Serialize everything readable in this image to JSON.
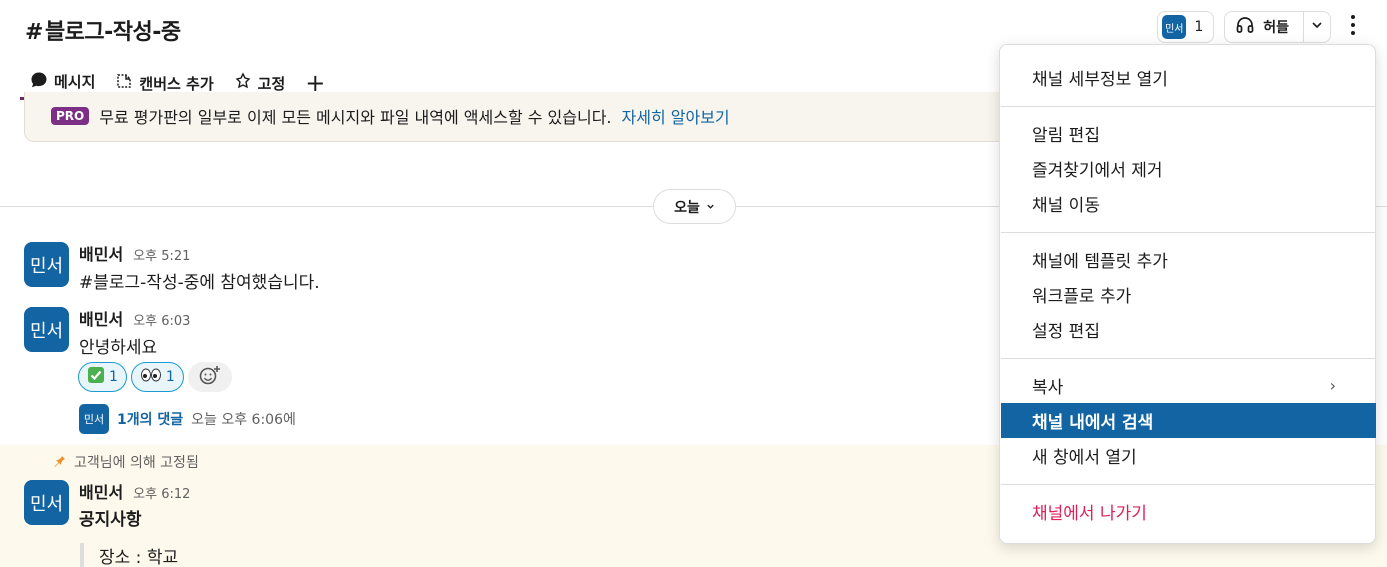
{
  "header": {
    "channel_hash": "#",
    "channel_name": "블로그-작성-중",
    "member_avatar": "민서",
    "member_count": "1",
    "huddle_label": "허들"
  },
  "tabs": [
    {
      "label": "메시지",
      "icon": "message-icon"
    },
    {
      "label": "캔버스 추가",
      "icon": "canvas-icon"
    },
    {
      "label": "고정",
      "icon": "pin-icon"
    }
  ],
  "add_tab": "+",
  "banner": {
    "badge": "PRO",
    "text": "무료 평가판의 일부로 이제 모든 메시지와 파일 내역에 액세스할 수 있습니다.",
    "link": "자세히 알아보기"
  },
  "date_divider": {
    "label": "오늘"
  },
  "messages": [
    {
      "avatar": "민서",
      "author": "배민서",
      "time": "오후 5:21",
      "text": "#블로그-작성-중에 참여했습니다."
    },
    {
      "avatar": "민서",
      "author": "배민서",
      "time": "오후 6:03",
      "text": "안녕하세요",
      "reactions": [
        {
          "emoji": "✅",
          "count": "1"
        },
        {
          "emoji": "👀",
          "count": "1"
        }
      ],
      "thread": {
        "avatar": "민서",
        "replies": "1개의 댓글",
        "last": "오늘 오후 6:06에"
      }
    },
    {
      "avatar": "민서",
      "author": "배민서",
      "time": "오후 6:12",
      "text": "공지사항",
      "pinned_by": "고객님에 의해 고정됨",
      "quote": "장소 : 학교"
    }
  ],
  "menu": {
    "items": [
      "채널 세부정보 열기",
      "알림 편집",
      "즐겨찾기에서 제거",
      "채널 이동",
      "채널에 템플릿 추가",
      "워크플로 추가",
      "설정 편집",
      "복사",
      "채널 내에서 검색",
      "새 창에서 열기",
      "채널에서 나가기"
    ],
    "highlighted": "채널 내에서 검색",
    "submenu_chevron": "›"
  },
  "colors": {
    "accent": "#1264a3",
    "tab_underline": "#6b2b69",
    "danger": "#e01e5a",
    "pro_badge": "#7c3085",
    "pinned_bg": "#fef9ed"
  }
}
